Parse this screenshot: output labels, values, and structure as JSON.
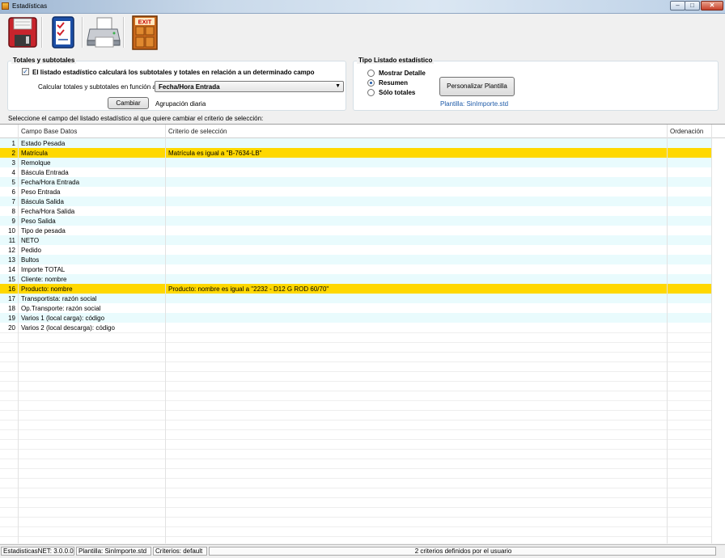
{
  "window": {
    "title": "Estadísticas"
  },
  "toolbar": {
    "icons": [
      "save-icon",
      "criteria-checklist-icon",
      "printer-icon",
      "exit-door-icon"
    ],
    "exit_label": "EXIT"
  },
  "totales": {
    "group_title": "Totales y subtotales",
    "checkbox_label": "El listado estadístico calculará los subtotales y totales en relación a un determinado campo",
    "checkbox_checked": true,
    "campo_label": "Calcular totales y subtotales en función a:",
    "campo_value": "Fecha/Hora Entrada",
    "cambiar_label": "Cambiar",
    "agrupacion": "Agrupación diaria"
  },
  "tipo": {
    "group_title": "Tipo Listado estadístico",
    "options": [
      {
        "label": "Mostrar Detalle",
        "selected": false
      },
      {
        "label": "Resumen",
        "selected": true
      },
      {
        "label": "Sólo totales",
        "selected": false
      }
    ],
    "personalizar_label": "Personalizar Plantilla",
    "plantilla_label": "Plantilla: SinImporte.std"
  },
  "hint": "Seleccione el campo del listado estadístico al que quiere cambiar el criterio de selección:",
  "grid": {
    "headers": {
      "field": "Campo Base Datos",
      "criteria": "Criterio de selección",
      "order": "Ordenación"
    },
    "rows": [
      {
        "num": "1",
        "field": "Estado Pesada",
        "criteria": ""
      },
      {
        "num": "2",
        "field": "Matrícula",
        "criteria": "Matrícula es igual a \"B-7634-LB\"",
        "highlight": true
      },
      {
        "num": "3",
        "field": "Remolque",
        "criteria": ""
      },
      {
        "num": "4",
        "field": "Báscula Entrada",
        "criteria": ""
      },
      {
        "num": "5",
        "field": "Fecha/Hora Entrada",
        "criteria": ""
      },
      {
        "num": "6",
        "field": "Peso Entrada",
        "criteria": ""
      },
      {
        "num": "7",
        "field": "Báscula Salida",
        "criteria": ""
      },
      {
        "num": "8",
        "field": "Fecha/Hora Salida",
        "criteria": ""
      },
      {
        "num": "9",
        "field": "Peso Salida",
        "criteria": ""
      },
      {
        "num": "10",
        "field": "Tipo de pesada",
        "criteria": ""
      },
      {
        "num": "11",
        "field": "NETO",
        "criteria": ""
      },
      {
        "num": "12",
        "field": "Pedido",
        "criteria": ""
      },
      {
        "num": "13",
        "field": "Bultos",
        "criteria": ""
      },
      {
        "num": "14",
        "field": "Importe TOTAL",
        "criteria": ""
      },
      {
        "num": "15",
        "field": "Cliente: nombre",
        "criteria": ""
      },
      {
        "num": "16",
        "field": "Producto: nombre",
        "criteria": "Producto: nombre es igual a \"2232 - D12 G  ROD 60/70\"",
        "highlight": true
      },
      {
        "num": "17",
        "field": "Transportista: razón social",
        "criteria": ""
      },
      {
        "num": "18",
        "field": "Op.Transporte: razón social",
        "criteria": ""
      },
      {
        "num": "19",
        "field": "Varios 1 (local carga): código",
        "criteria": ""
      },
      {
        "num": "20",
        "field": "Varios 2 (local descarga): código",
        "criteria": ""
      }
    ]
  },
  "status": {
    "version": "EstadisticasNET: 3.0.0.0",
    "plantilla": "Plantilla: SinImporte.std",
    "criterios": "Criterios: default",
    "summary": "2 criterios definidos por el usuario"
  },
  "colors": {
    "highlight": "#ffd800",
    "alt_row": "#e9fbfd",
    "link_blue": "#1d5aa8"
  }
}
